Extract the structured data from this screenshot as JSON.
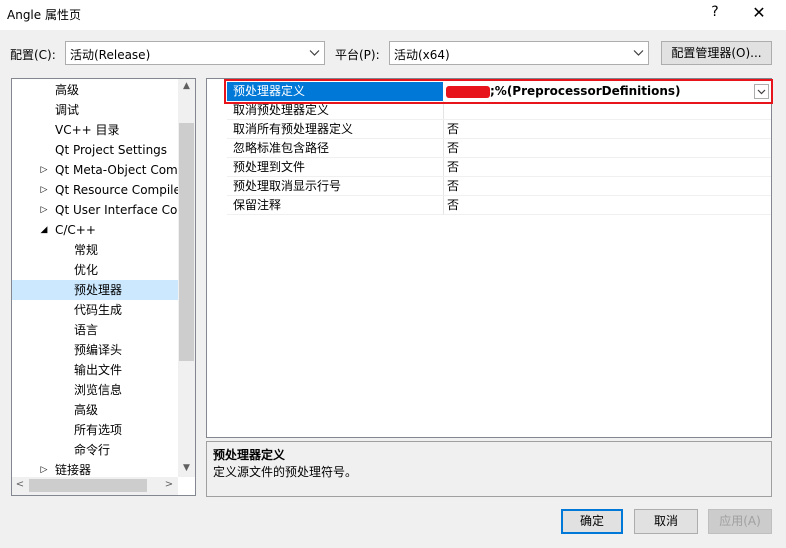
{
  "window": {
    "title": "Angle 属性页",
    "help": "?",
    "close": "✕"
  },
  "config": {
    "label": "配置(C):",
    "value": "活动(Release)"
  },
  "platform": {
    "label": "平台(P):",
    "value": "活动(x64)"
  },
  "config_manager_label": "配置管理器(O)...",
  "tree": {
    "items": [
      {
        "label": "高级",
        "indent": 1
      },
      {
        "label": "调试",
        "indent": 1
      },
      {
        "label": "VC++ 目录",
        "indent": 1
      },
      {
        "label": "Qt Project Settings",
        "indent": 1
      },
      {
        "label": "Qt Meta-Object Compiler",
        "indent": 1,
        "expander": "▷"
      },
      {
        "label": "Qt Resource Compiler",
        "indent": 1,
        "expander": "▷"
      },
      {
        "label": "Qt User Interface Compiler",
        "indent": 1,
        "expander": "▷"
      },
      {
        "label": "C/C++",
        "indent": 1,
        "expander": "◢"
      },
      {
        "label": "常规",
        "indent": 2
      },
      {
        "label": "优化",
        "indent": 2
      },
      {
        "label": "预处理器",
        "indent": 2,
        "selected": true
      },
      {
        "label": "代码生成",
        "indent": 2
      },
      {
        "label": "语言",
        "indent": 2
      },
      {
        "label": "预编译头",
        "indent": 2
      },
      {
        "label": "输出文件",
        "indent": 2
      },
      {
        "label": "浏览信息",
        "indent": 2
      },
      {
        "label": "高级",
        "indent": 2
      },
      {
        "label": "所有选项",
        "indent": 2
      },
      {
        "label": "命令行",
        "indent": 2
      },
      {
        "label": "链接器",
        "indent": 1,
        "expander": "▷"
      }
    ]
  },
  "grid": {
    "rows": [
      {
        "name": "预处理器定义",
        "value": ";%(PreprocessorDefinitions)",
        "selected": true
      },
      {
        "name": "取消预处理器定义",
        "value": ""
      },
      {
        "name": "取消所有预处理器定义",
        "value": "否"
      },
      {
        "name": "忽略标准包含路径",
        "value": "否"
      },
      {
        "name": "预处理到文件",
        "value": "否"
      },
      {
        "name": "预处理取消显示行号",
        "value": "否"
      },
      {
        "name": "保留注释",
        "value": "否"
      }
    ]
  },
  "description": {
    "title": "预处理器定义",
    "text": "定义源文件的预处理符号。"
  },
  "buttons": {
    "ok": "确定",
    "cancel": "取消",
    "apply": "应用(A)"
  }
}
